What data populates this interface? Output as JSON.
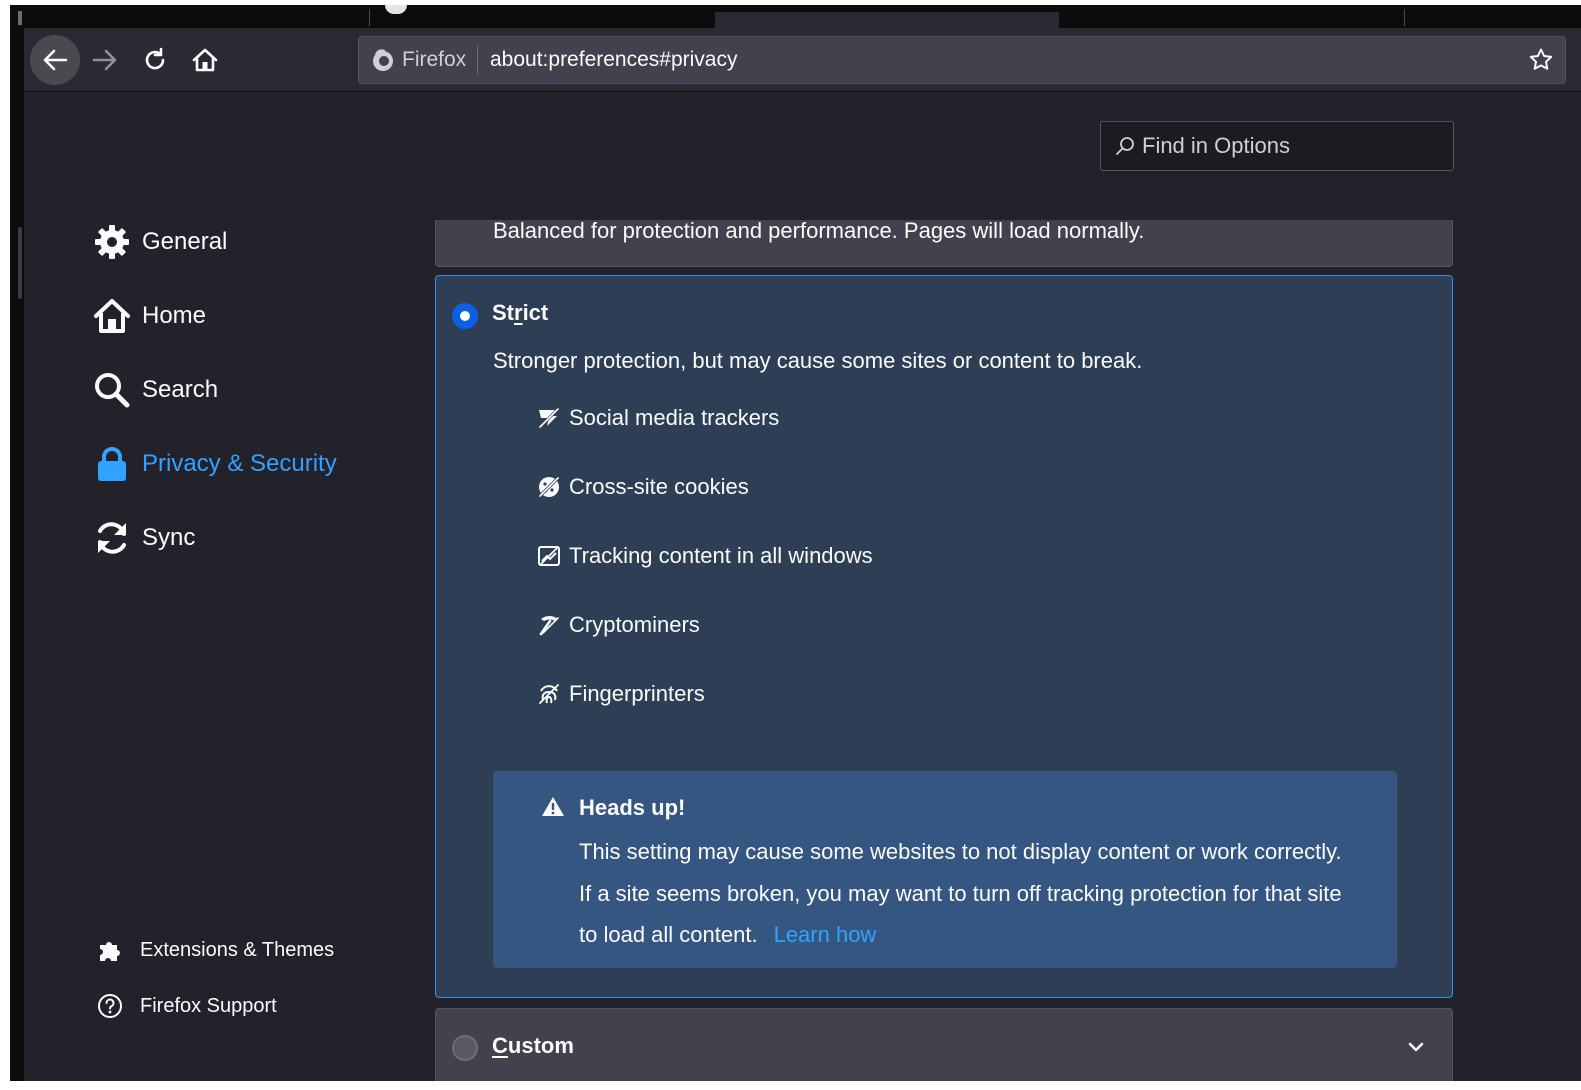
{
  "browser": {
    "identity_label": "Firefox",
    "url": "about:preferences#privacy"
  },
  "search": {
    "placeholder": "Find in Options"
  },
  "sidebar": {
    "items": [
      {
        "label": "General",
        "icon": "gear-icon"
      },
      {
        "label": "Home",
        "icon": "home-icon"
      },
      {
        "label": "Search",
        "icon": "search-icon"
      },
      {
        "label": "Privacy & Security",
        "icon": "lock-icon",
        "selected": true
      },
      {
        "label": "Sync",
        "icon": "sync-icon"
      }
    ],
    "footer": [
      {
        "label": "Extensions & Themes",
        "icon": "puzzle-icon"
      },
      {
        "label": "Firefox Support",
        "icon": "help-icon"
      }
    ]
  },
  "protection": {
    "standard": {
      "description": "Balanced for protection and performance. Pages will load normally."
    },
    "strict": {
      "title_pre": "St",
      "title_accel": "r",
      "title_post": "ict",
      "selected": true,
      "description": "Stronger protection, but may cause some sites or content to break.",
      "features": [
        {
          "label": "Social media trackers",
          "icon": "social-tracker-blocked-icon"
        },
        {
          "label": "Cross-site cookies",
          "icon": "cookie-blocked-icon"
        },
        {
          "label": "Tracking content in all windows",
          "icon": "tracking-content-blocked-icon"
        },
        {
          "label": "Cryptominers",
          "icon": "cryptominer-blocked-icon"
        },
        {
          "label": "Fingerprinters",
          "icon": "fingerprinter-blocked-icon"
        }
      ],
      "warning": {
        "title": "Heads up!",
        "text": "This setting may cause some websites to not display content or work correctly. If a site seems broken, you may want to turn off tracking protection for that site to load all content.",
        "link": "Learn how"
      }
    },
    "custom": {
      "title_accel": "C",
      "title_post": "ustom",
      "selected": false
    }
  },
  "colors": {
    "accent": "#2fa3ff",
    "selected_card": "#2e3f55",
    "warning_bg": "#355680",
    "radio_on": "#0a60e8"
  }
}
